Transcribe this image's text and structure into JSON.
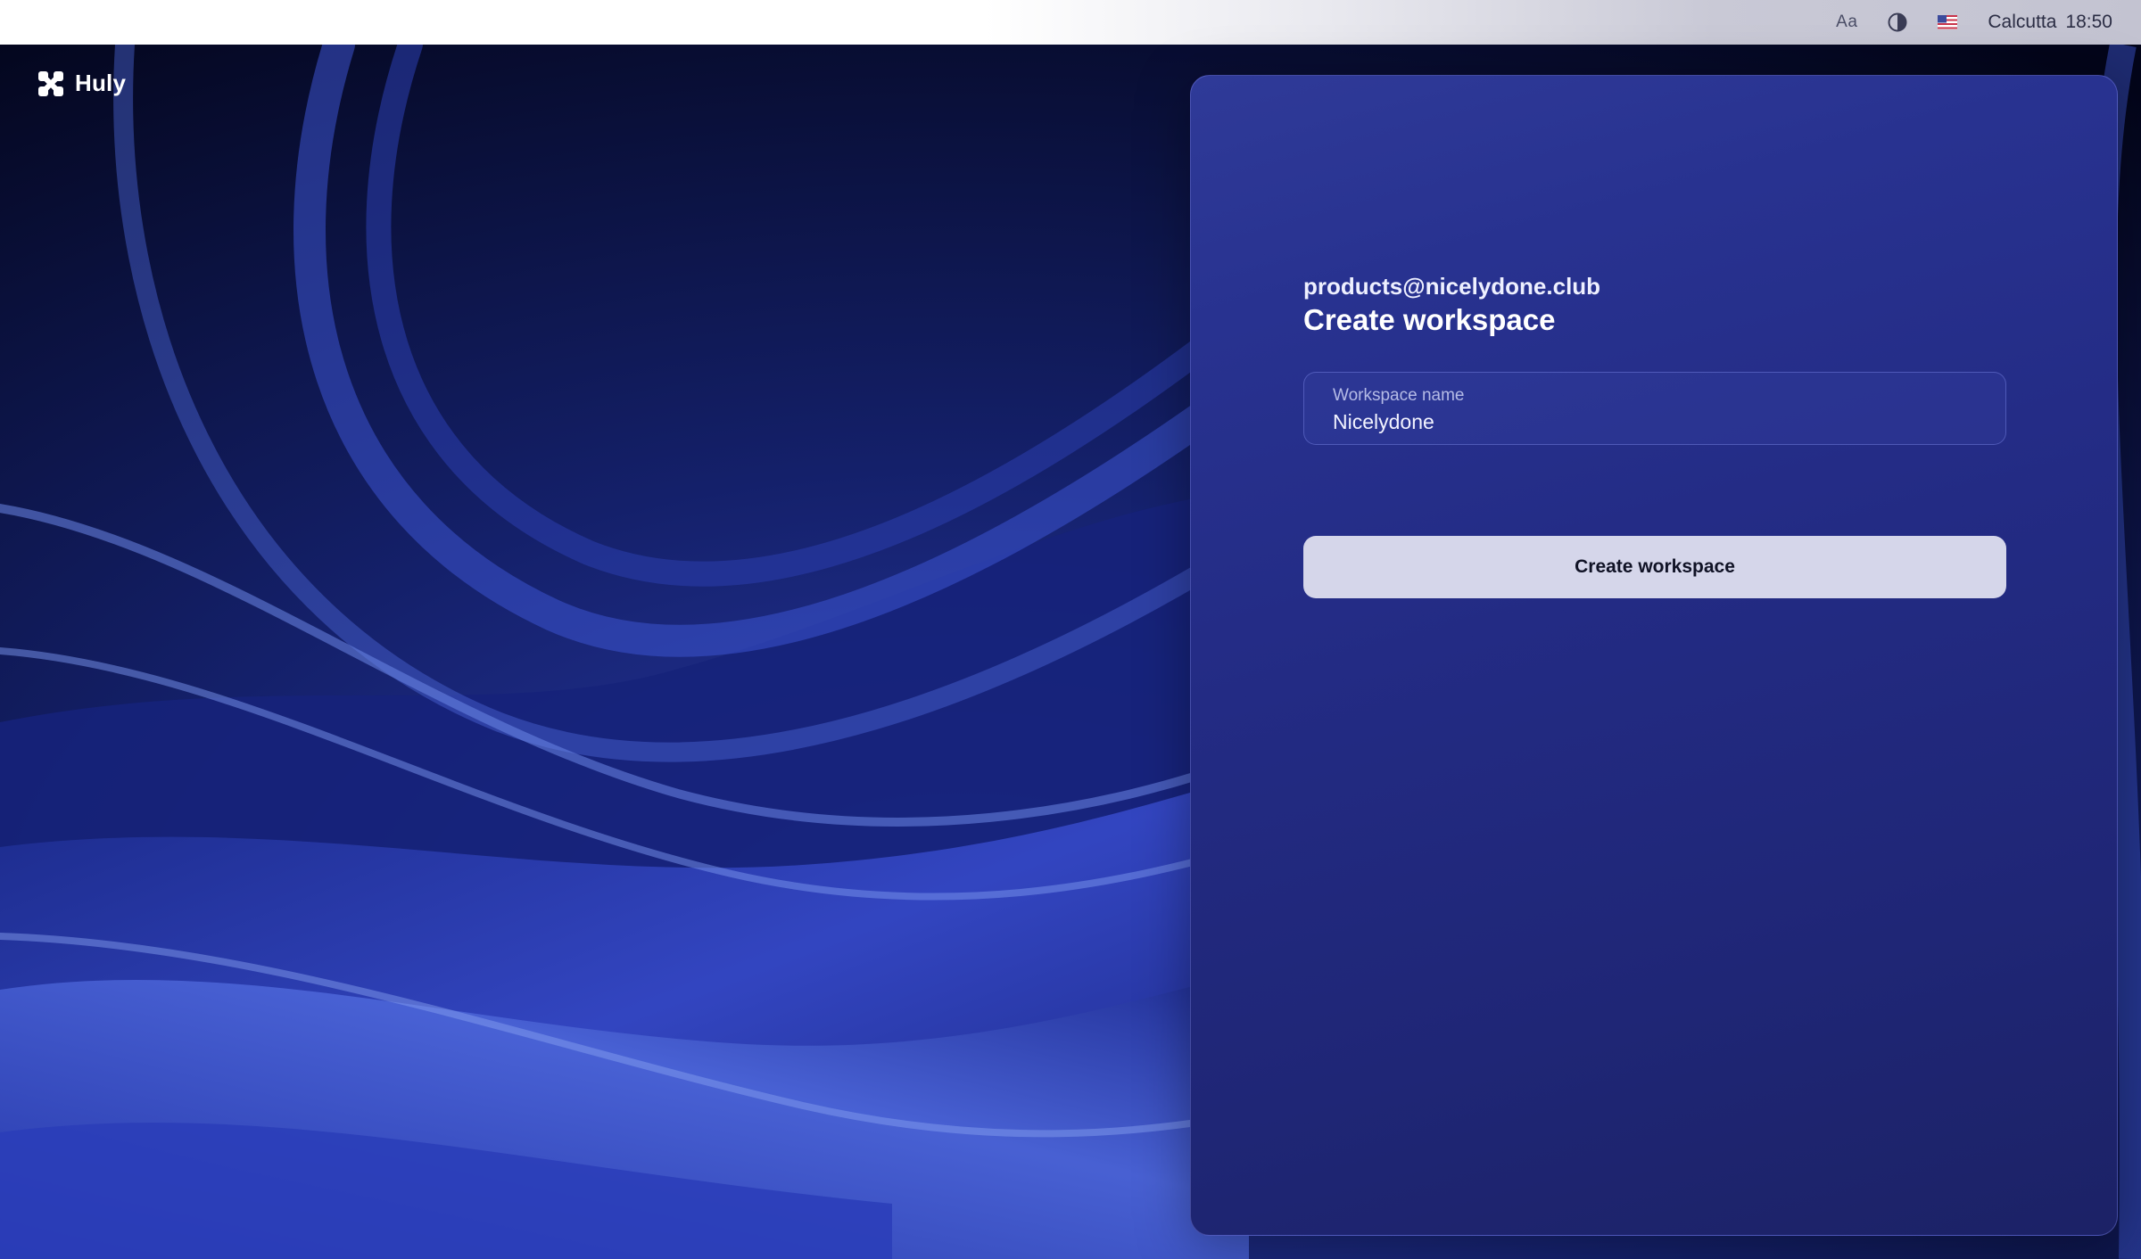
{
  "app": {
    "brand_name": "Huly",
    "logo_icon": "huly-logo-icon"
  },
  "system_bar": {
    "font_size_label": "Aa",
    "theme_icon": "contrast-icon",
    "language_icon": "us-flag-icon",
    "timezone": "Calcutta",
    "time": "18:50"
  },
  "form": {
    "account_email": "products@nicelydone.club",
    "title": "Create workspace",
    "workspace_field": {
      "label": "Workspace name",
      "value": "Nicelydone"
    },
    "submit_label": "Create workspace"
  },
  "colors": {
    "panel": "#232b84",
    "button": "#d5d6ea",
    "background": "#05081c"
  }
}
